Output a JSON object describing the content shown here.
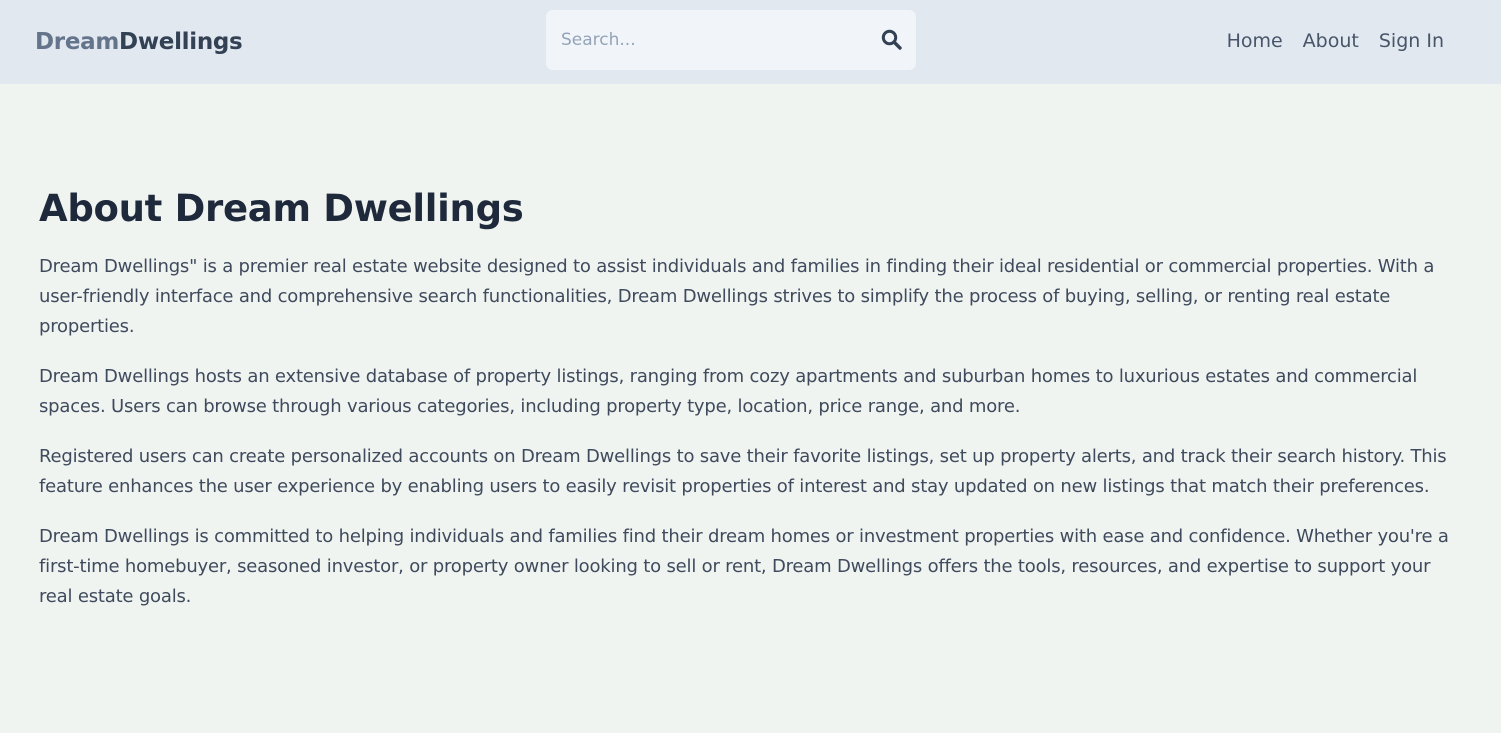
{
  "header": {
    "brand_part1": "Dream",
    "brand_part2": "Dwellings",
    "search_placeholder": "Search...",
    "search_icon": "search-icon",
    "nav": {
      "home": "Home",
      "about": "About",
      "sign_in": "Sign In"
    }
  },
  "main": {
    "title": "About Dream Dwellings",
    "paragraphs": [
      "Dream Dwellings\" is a premier real estate website designed to assist individuals and families in finding their ideal residential or commercial properties. With a user-friendly interface and comprehensive search functionalities, Dream Dwellings strives to simplify the process of buying, selling, or renting real estate properties.",
      "Dream Dwellings hosts an extensive database of property listings, ranging from cozy apartments and suburban homes to luxurious estates and commercial spaces. Users can browse through various categories, including property type, location, price range, and more.",
      "Registered users can create personalized accounts on Dream Dwellings to save their favorite listings, set up property alerts, and track their search history. This feature enhances the user experience by enabling users to easily revisit properties of interest and stay updated on new listings that match their preferences.",
      "Dream Dwellings is committed to helping individuals and families find their dream homes or investment properties with ease and confidence. Whether you're a first-time homebuyer, seasoned investor, or property owner looking to sell or rent, Dream Dwellings offers the tools, resources, and expertise to support your real estate goals."
    ]
  },
  "colors": {
    "header_bg": "#e2e8f0",
    "page_bg": "#f0f4f1",
    "heading": "#1e293b",
    "body_text": "#3f4a5c",
    "brand_light": "#64748b",
    "brand_dark": "#334155"
  }
}
